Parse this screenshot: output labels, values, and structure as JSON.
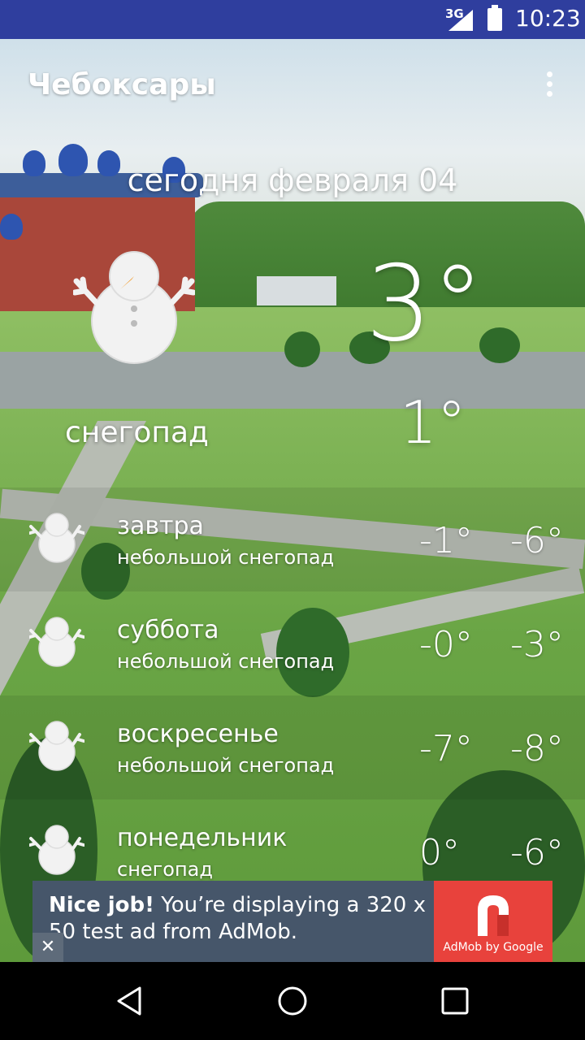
{
  "status_bar": {
    "network": "3G",
    "time": "10:23"
  },
  "header": {
    "city": "Чебоксары"
  },
  "current": {
    "date_label": "сегодня  февраля 04",
    "temp_high": "3°",
    "temp_low": "1°",
    "condition": "снегопад",
    "icon": "snowman-icon"
  },
  "forecast": [
    {
      "day": "завтра",
      "desc": "небольшой снегопад",
      "high": "-1°",
      "low": "-6°",
      "icon": "snowman-icon"
    },
    {
      "day": "суббота",
      "desc": "небольшой снегопад",
      "high": "-0°",
      "low": "-3°",
      "icon": "snowman-icon"
    },
    {
      "day": "воскресенье",
      "desc": "небольшой снегопад",
      "high": "-7°",
      "low": "-8°",
      "icon": "snowman-icon"
    },
    {
      "day": "понедельник",
      "desc": "снегопад",
      "high": "0°",
      "low": "-6°",
      "icon": "snowman-icon"
    }
  ],
  "ad": {
    "headline": "Nice job!",
    "body": " You’re displaying a 320 x 50 test ad from AdMob.",
    "brand": "AdMob by Google",
    "close": "✕"
  },
  "colors": {
    "status_bar": "#2f3e9e",
    "ad_bg": "#46566a",
    "ad_logo": "#e8423c"
  }
}
